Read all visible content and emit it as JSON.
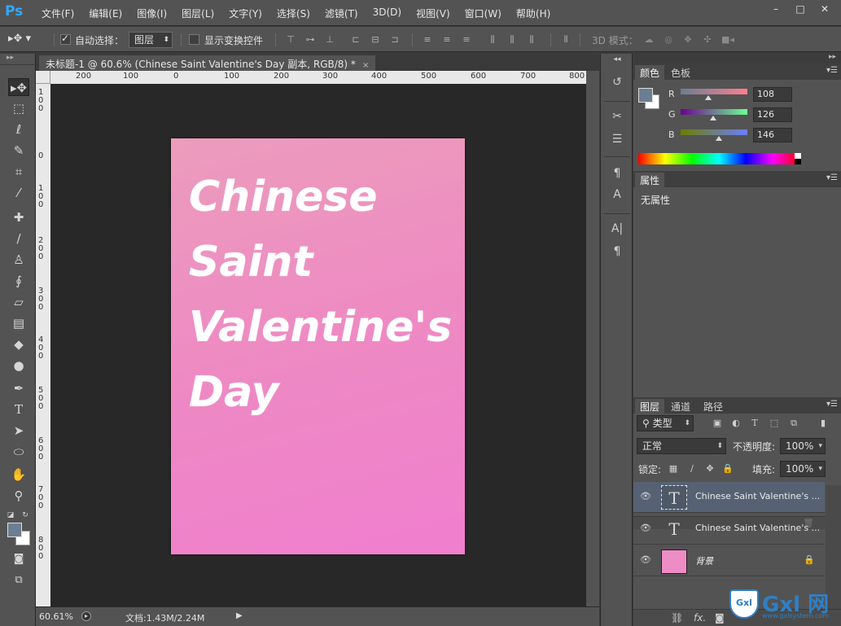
{
  "app": {
    "logo": "Ps",
    "menu": [
      "文件(F)",
      "编辑(E)",
      "图像(I)",
      "图层(L)",
      "文字(Y)",
      "选择(S)",
      "滤镜(T)",
      "3D(D)",
      "视图(V)",
      "窗口(W)",
      "帮助(H)"
    ],
    "window_controls": [
      "–",
      "□",
      "✕"
    ]
  },
  "options_bar": {
    "auto_select_label": "自动选择：",
    "auto_select_checked": true,
    "layer_select_value": "图层",
    "show_transform_label": "显示变换控件",
    "show_transform_checked": false,
    "mode_3d_label": "3D 模式："
  },
  "document": {
    "tab_title": "未标题-1 @ 60.6% (Chinese  Saint  Valentine's  Day 副本, RGB/8) *",
    "close_glyph": "×",
    "ruler_top_labels": [
      "200",
      "100",
      "0",
      "100",
      "200",
      "300",
      "400",
      "500",
      "600",
      "700",
      "800"
    ],
    "ruler_left_labels": [
      "100",
      "0",
      "100",
      "200",
      "300",
      "400",
      "500",
      "600",
      "700",
      "800"
    ],
    "canvas_text_lines": [
      "Chinese",
      "Saint",
      "Valentine's",
      "Day"
    ],
    "canvas_gradient": [
      "#ec9cbc",
      "#f07fcf"
    ]
  },
  "status": {
    "zoom": "60.61%",
    "doc_info": "文档:1.43M/2.24M"
  },
  "toolbox": {
    "tools": [
      "move-tool",
      "marquee-tool",
      "lasso-tool",
      "quick-select-tool",
      "crop-tool",
      "eyedropper-tool",
      "healing-tool",
      "brush-tool",
      "stamp-tool",
      "history-brush-tool",
      "eraser-tool",
      "gradient-tool",
      "blur-tool",
      "dodge-tool",
      "pen-tool",
      "type-tool",
      "path-select-tool",
      "shape-tool",
      "hand-tool",
      "zoom-tool"
    ],
    "foreground_color": "#6c7e92",
    "background_color": "#ffffff"
  },
  "color_panel": {
    "tabs": [
      "颜色",
      "色板"
    ],
    "channels": [
      {
        "label": "R",
        "value": "108",
        "fraction": 0.42
      },
      {
        "label": "G",
        "value": "126",
        "fraction": 0.49
      },
      {
        "label": "B",
        "value": "146",
        "fraction": 0.57
      }
    ]
  },
  "properties_panel": {
    "tab": "属性",
    "empty_text": "无属性"
  },
  "layers_panel": {
    "tabs": [
      "图层",
      "通道",
      "路径"
    ],
    "filter_kind": "类型",
    "blend_mode": "正常",
    "opacity_label": "不透明度:",
    "opacity_value": "100%",
    "lock_label": "锁定:",
    "fill_label": "填充:",
    "fill_value": "100%",
    "layers": [
      {
        "name": "Chinese  Saint  Valentine's ...",
        "type": "text",
        "selected": true
      },
      {
        "name": "Chinese  Saint  Valentine's ...",
        "type": "text",
        "selected": false
      },
      {
        "name": "背景",
        "type": "background",
        "selected": false,
        "locked": true
      }
    ],
    "footer_icons": [
      "link-icon",
      "fx-icon",
      "mask-icon"
    ]
  },
  "watermark": {
    "name": "Gxl 网",
    "url": "www.gxlsystem.com",
    "badge": "Gxl"
  }
}
